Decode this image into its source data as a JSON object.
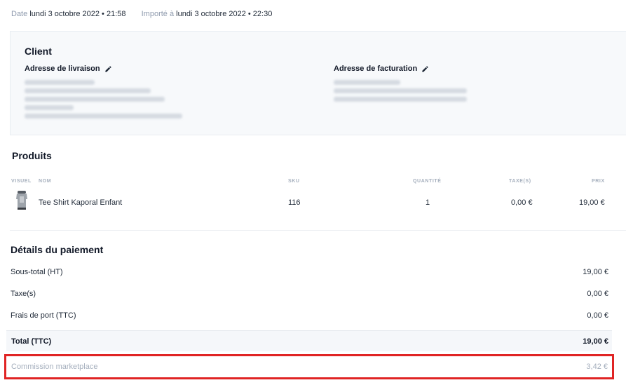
{
  "meta": {
    "date_label": "Date",
    "date_value": "lundi 3 octobre 2022 • 21:58",
    "imported_label": "Importé à",
    "imported_value": "lundi 3 octobre 2022 • 22:30"
  },
  "client": {
    "title": "Client",
    "shipping_label": "Adresse de livraison",
    "billing_label": "Adresse de facturation",
    "edit_icon": "pencil-icon"
  },
  "products": {
    "title": "Produits",
    "columns": [
      "VISUEL",
      "NOM",
      "SKU",
      "QUANTITÉ",
      "TAXE(S)",
      "PRIX"
    ],
    "rows": [
      {
        "name": "Tee Shirt Kaporal Enfant",
        "sku": "116",
        "quantity": "1",
        "tax": "0,00 €",
        "price": "19,00 €"
      }
    ]
  },
  "payment": {
    "title": "Détails du paiement",
    "subtotal_label": "Sous-total (HT)",
    "subtotal_value": "19,00 €",
    "tax_label": "Taxe(s)",
    "tax_value": "0,00 €",
    "shipping_label": "Frais de port (TTC)",
    "shipping_value": "0,00 €",
    "total_label": "Total (TTC)",
    "total_value": "19,00 €",
    "commission_label": "Commission marketplace",
    "commission_value": "3,42 €",
    "highlight_color": "#e02424"
  }
}
